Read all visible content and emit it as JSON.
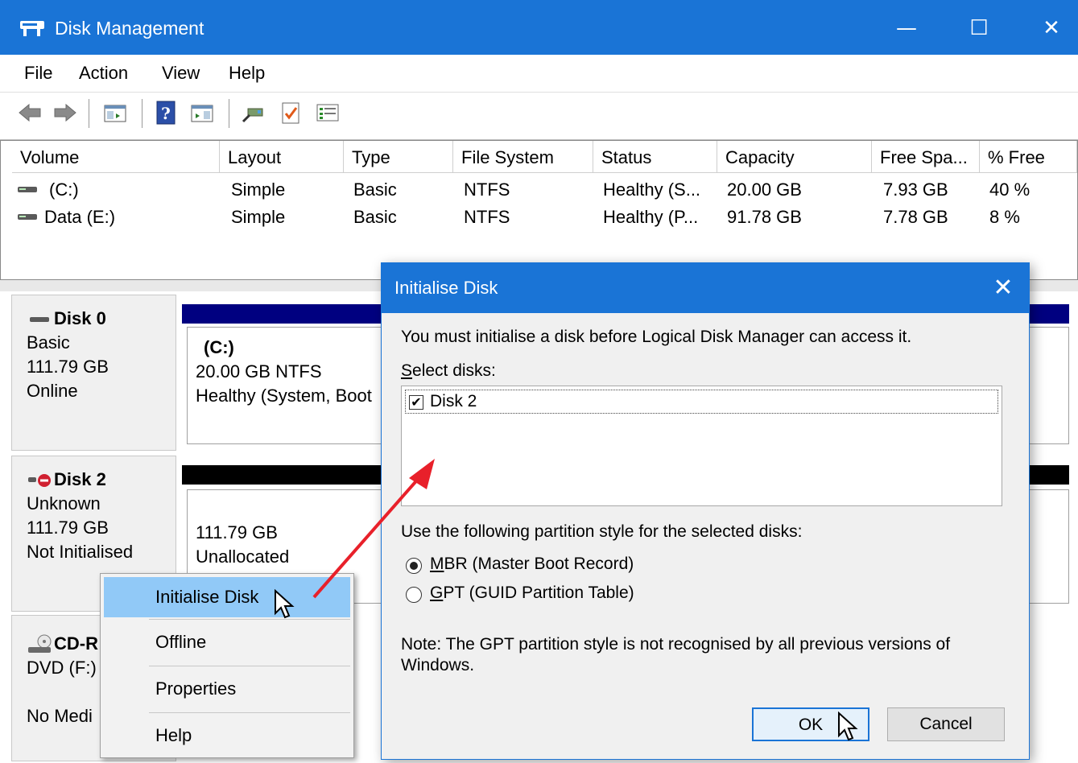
{
  "window": {
    "title": "Disk Management",
    "minimize": "—",
    "maximize": "☐",
    "close": "✕"
  },
  "menu": [
    "File",
    "Action",
    "View",
    "Help"
  ],
  "toolbar": {
    "icons": [
      "back-icon",
      "forward-icon",
      "show-hide-console-tree-icon",
      "help-icon",
      "show-hide-action-pane-icon",
      "connect-icon",
      "checklist-icon",
      "properties-list-icon"
    ]
  },
  "volumes": {
    "columns": [
      "Volume",
      "Layout",
      "Type",
      "File System",
      "Status",
      "Capacity",
      "Free Spa...",
      "% Free"
    ],
    "rows": [
      [
        "(C:)",
        "Simple",
        "Basic",
        "NTFS",
        "Healthy (S...",
        "20.00 GB",
        "7.93 GB",
        "40 %"
      ],
      [
        "Data (E:)",
        "Simple",
        "Basic",
        "NTFS",
        "Healthy (P...",
        "91.78 GB",
        "7.78 GB",
        "8 %"
      ]
    ]
  },
  "disks": {
    "disk0": {
      "name": "Disk 0",
      "type": "Basic",
      "size": "111.79 GB",
      "status": "Online",
      "partition": {
        "label": "(C:)",
        "size": "20.00 GB NTFS",
        "status": "Healthy (System, Boot"
      }
    },
    "disk2": {
      "name": "Disk 2",
      "type": "Unknown",
      "size": "111.79 GB",
      "status": "Not Initialised",
      "partition": {
        "size": "111.79 GB",
        "status": "Unallocated"
      }
    },
    "cdrom": {
      "name": "CD-R",
      "type": "DVD (F:)",
      "status": "No Medi"
    }
  },
  "context_menu": {
    "items": [
      "Initialise Disk",
      "Offline",
      "Properties",
      "Help"
    ],
    "selected": "Initialise Disk"
  },
  "dialog": {
    "title": "Initialise Disk",
    "message": "You must initialise a disk before Logical Disk Manager can access it.",
    "select_label_u": "S",
    "select_label_rest": "elect disks:",
    "disks": [
      {
        "label": "Disk 2",
        "checked": true
      }
    ],
    "partition_label": "Use the following partition style for the selected disks:",
    "mbr_u": "M",
    "mbr_rest": "BR (Master Boot Record)",
    "gpt_u": "G",
    "gpt_rest": "PT (GUID Partition Table)",
    "selected_style": "MBR",
    "note_line1": "Note: The GPT partition style is not recognised by all previous versions of",
    "note_line2": "Windows.",
    "ok": "OK",
    "cancel": "Cancel"
  },
  "colors": {
    "accent": "#1a74d6",
    "menu_highlight": "#91c9f7",
    "arrow": "#e8202a",
    "disk_bar_blue": "#000080",
    "disk_bar_black": "#000000"
  }
}
